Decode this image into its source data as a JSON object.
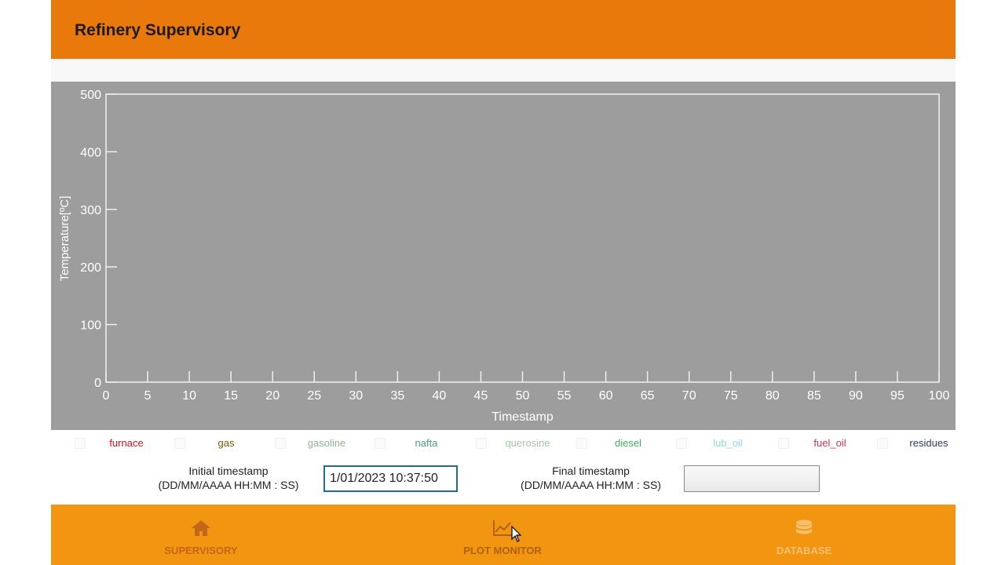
{
  "header": {
    "title": "Refinery Supervisory"
  },
  "chart_data": {
    "type": "line",
    "ylabel": "Temperature[ºC]",
    "xlabel": "Timestamp",
    "ylim": [
      0,
      500
    ],
    "xlim": [
      0,
      100
    ],
    "yticks": [
      "0",
      "100",
      "200",
      "300",
      "400",
      "500"
    ],
    "xticks": [
      "0",
      "5",
      "10",
      "15",
      "20",
      "25",
      "30",
      "35",
      "40",
      "45",
      "50",
      "55",
      "60",
      "65",
      "70",
      "75",
      "80",
      "85",
      "90",
      "95",
      "100"
    ],
    "series": [],
    "grid": false,
    "background": "#9d9d9d"
  },
  "legend": [
    {
      "label": "furnace",
      "color": "#d4141e"
    },
    {
      "label": "gas",
      "color": "#7a5a10"
    },
    {
      "label": "gasoline",
      "color": "#8fb38f"
    },
    {
      "label": "nafta",
      "color": "#4c9a8a"
    },
    {
      "label": "querosine",
      "color": "#a6c4a6"
    },
    {
      "label": "diesel",
      "color": "#3fae5e"
    },
    {
      "label": "lub_oil",
      "color": "#8fd8d8"
    },
    {
      "label": "fuel_oil",
      "color": "#d8324c"
    },
    {
      "label": "residues",
      "color": "#2a3a6a"
    }
  ],
  "timestamps": {
    "initial_label": "Initial timestamp",
    "initial_format": "(DD/MM/AAAA HH:MM : SS)",
    "initial_value": "1/01/2023 10:37:50",
    "final_label": "Final timestamp",
    "final_format": "(DD/MM/AAAA HH:MM : SS)",
    "final_value": ""
  },
  "nav": {
    "items": [
      {
        "label": "SUPERVISORY",
        "icon": "home-icon",
        "color": "#c2661a"
      },
      {
        "label": "PLOT MONITOR",
        "icon": "chart-line-icon",
        "color": "#b0620f"
      },
      {
        "label": "DATABASE",
        "icon": "database-icon",
        "color": "#f7c070"
      }
    ]
  },
  "colors": {
    "header": "#e8790a",
    "nav": "#f29511"
  }
}
